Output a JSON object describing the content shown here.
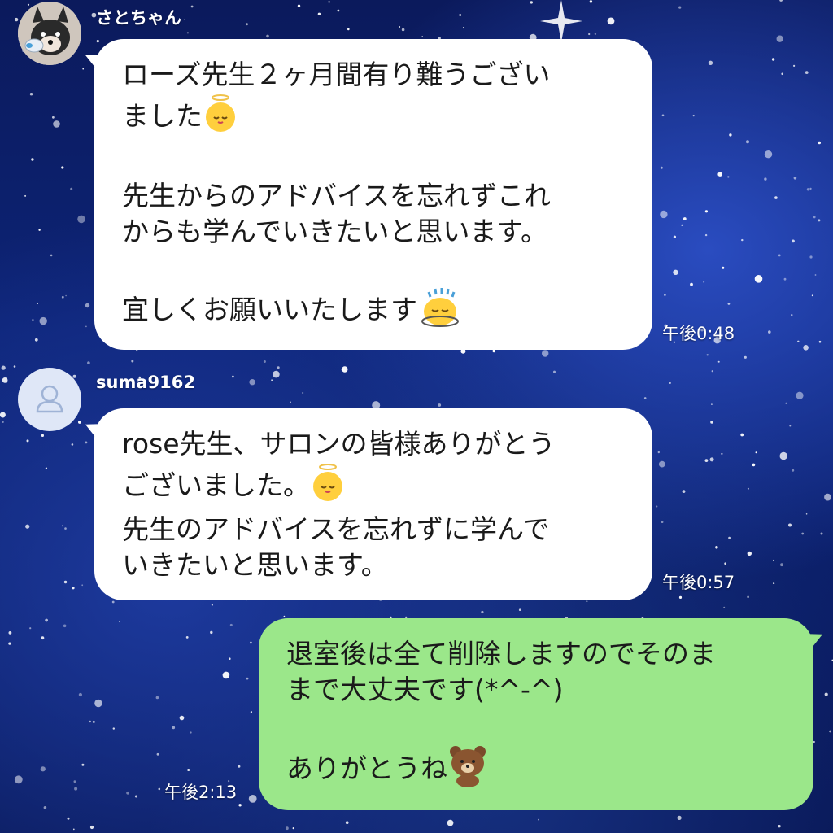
{
  "messages": [
    {
      "sender": "さとちゃん",
      "lines": [
        "ローズ先生２ヶ月間有り難うござい",
        "ました",
        "先生からのアドバイスを忘れずこれ",
        "からも学んでいきたいと思います。",
        "宜しくお願いいたします"
      ],
      "time": "午後0:48",
      "emojis": [
        "angel-chick-emoji",
        "bowing-chick-emoji"
      ]
    },
    {
      "sender": "suma9162",
      "lines": [
        "rose先生、サロンの皆様ありがとう",
        "ございました。",
        "先生のアドバイスを忘れずに学んで",
        "いきたいと思います。"
      ],
      "time": "午後0:57",
      "emojis": [
        "angel-chick-emoji"
      ]
    },
    {
      "sender": "",
      "lines": [
        "退室後は全て削除しますのでそのま",
        "まで大丈夫です(*^-^)",
        "ありがとうね"
      ],
      "time": "午後2:13",
      "emojis": [
        "brown-bear-emoji"
      ]
    }
  ],
  "colors": {
    "incoming_bubble": "#ffffff",
    "outgoing_bubble": "#9be78a",
    "background": "#0d2477"
  }
}
